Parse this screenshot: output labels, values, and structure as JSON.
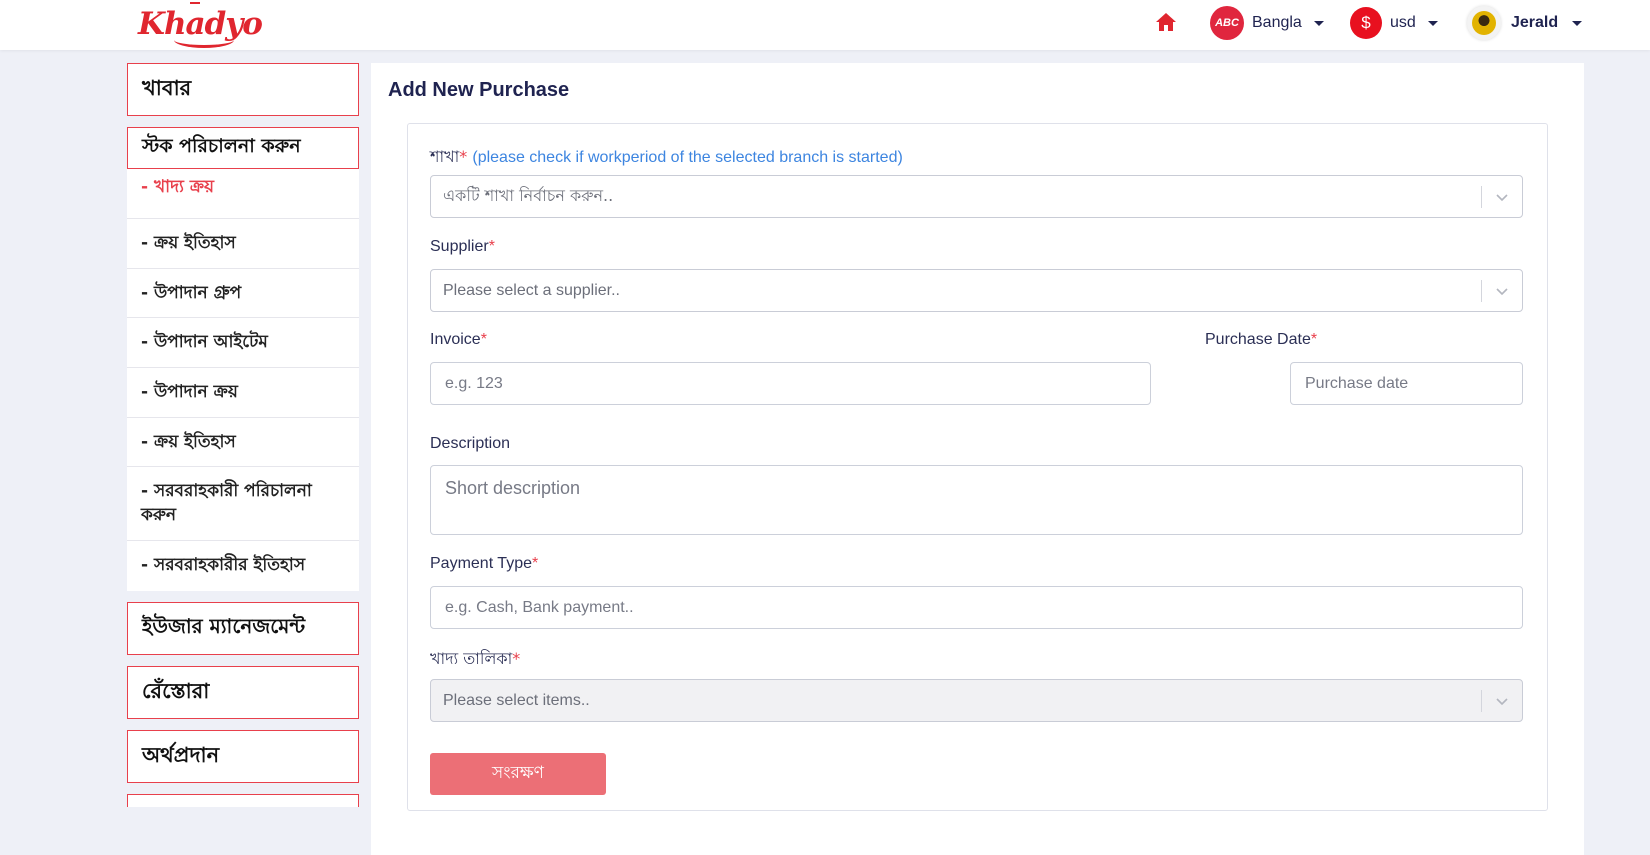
{
  "brand": {
    "logo_text": "Khadyo",
    "accent": "#e8404c"
  },
  "header": {
    "home_icon": "home-icon",
    "language": {
      "badge": "ABC",
      "label": "Bangla"
    },
    "currency": {
      "badge": "$",
      "label": "usd"
    },
    "user": {
      "name": "Jerald"
    }
  },
  "sidebar": {
    "items": [
      {
        "label": "খাবার",
        "type": "section"
      },
      {
        "label": "স্টক পরিচালনা করুন",
        "type": "section"
      },
      {
        "label": "- খাদ্য ক্রয়",
        "type": "sub",
        "active": true
      },
      {
        "label": "- ক্রয় ইতিহাস",
        "type": "sub"
      },
      {
        "label": "- উপাদান গ্রুপ",
        "type": "sub"
      },
      {
        "label": "- উপাদান আইটেম",
        "type": "sub"
      },
      {
        "label": "- উপাদান ক্রয়",
        "type": "sub"
      },
      {
        "label": "- ক্রয় ইতিহাস",
        "type": "sub"
      },
      {
        "label": "- সরবরাহকারী পরিচালনা করুন",
        "type": "sub"
      },
      {
        "label": "- সরবরাহকারীর ইতিহাস",
        "type": "sub"
      },
      {
        "label": "ইউজার ম্যানেজমেন্ট",
        "type": "section"
      },
      {
        "label": "রেঁস্তোরা",
        "type": "section"
      },
      {
        "label": "অর্থপ্রদান",
        "type": "section"
      }
    ]
  },
  "form": {
    "title": "Add New Purchase",
    "branch": {
      "label": "শাখা",
      "hint": "(please check if workperiod of the selected branch is started)",
      "placeholder": "একটি শাখা নির্বাচন করুন.."
    },
    "supplier": {
      "label": "Supplier",
      "placeholder": "Please select a supplier.."
    },
    "invoice": {
      "label": "Invoice",
      "placeholder": "e.g. 123"
    },
    "purchase_date": {
      "label": "Purchase Date",
      "placeholder": "Purchase date"
    },
    "description": {
      "label": "Description",
      "placeholder": "Short description"
    },
    "payment_type": {
      "label": "Payment Type",
      "placeholder": "e.g. Cash, Bank payment.."
    },
    "items": {
      "label": "খাদ্য তালিকা",
      "placeholder": "Please select items.."
    },
    "required_mark": "*",
    "save_label": "সংরক্ষণ"
  }
}
